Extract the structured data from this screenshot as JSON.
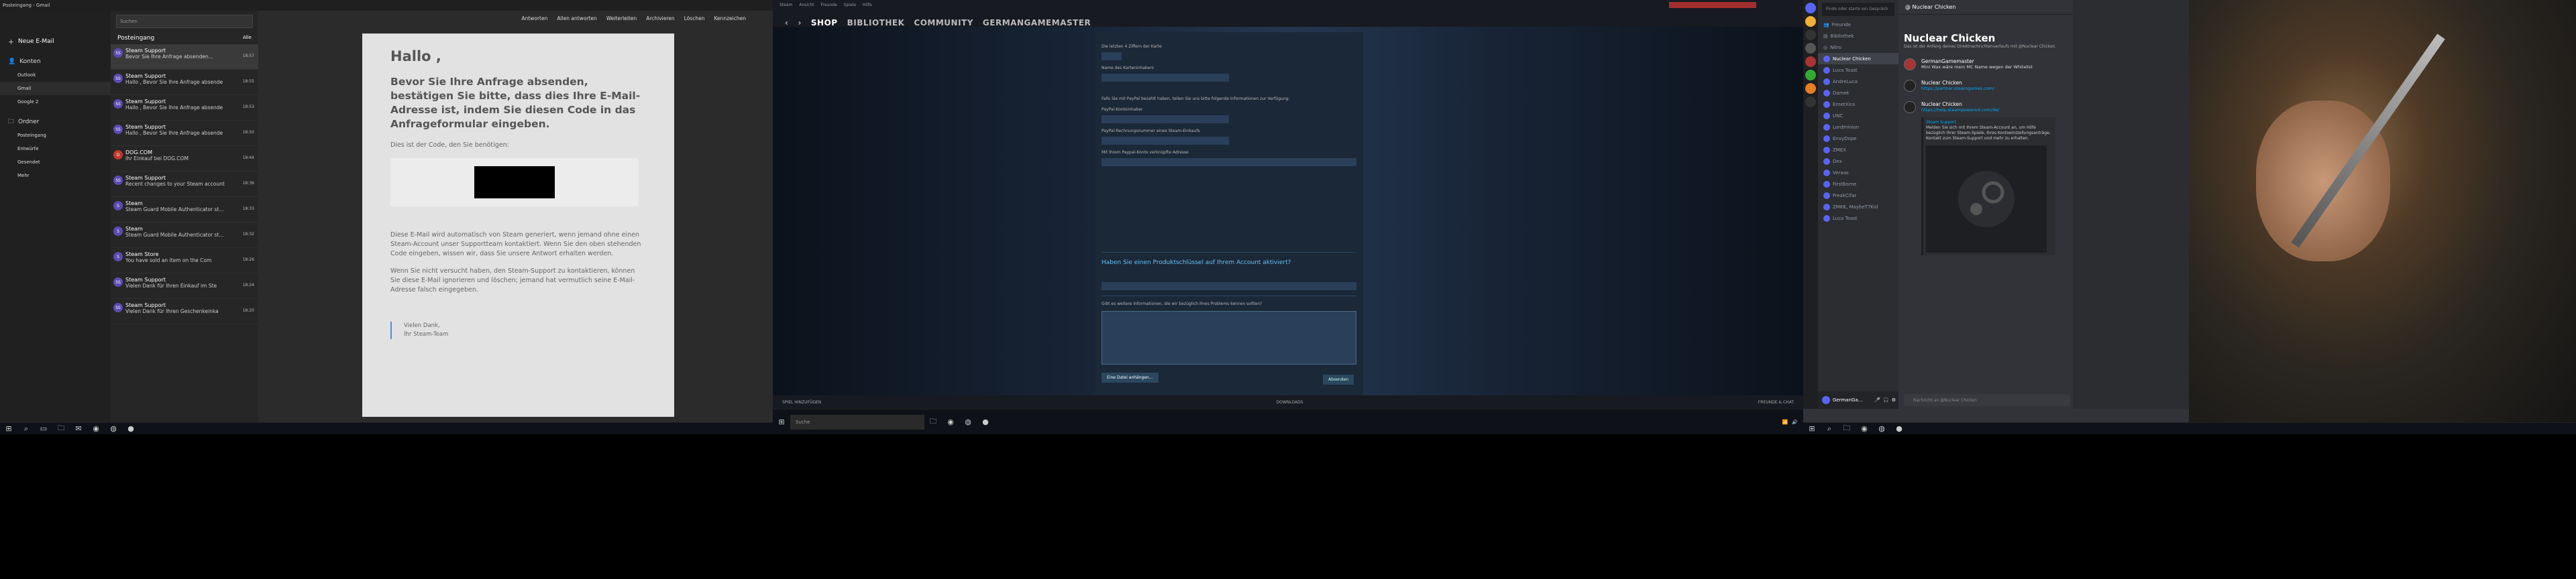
{
  "mail": {
    "title": "Posteingang - Gmail",
    "search_placeholder": "Suchen",
    "new_mail": "Neue E-Mail",
    "accounts": "Konten",
    "folders_label": "Ordner",
    "nav_items": [
      "Outlook",
      "Gmail",
      "Google 2"
    ],
    "folders": [
      "Posteingang",
      "Entwürfe",
      "Gesendet",
      "Mehr"
    ],
    "list_header": "Posteingang",
    "list_filter": "Alle",
    "messages": [
      {
        "sender": "Steam Support",
        "subject": "Bevor Sie Ihre Anfrage absenden...",
        "time": "18:57"
      },
      {
        "sender": "Steam Support",
        "subject": "Hallo , Bevor Sie Ihre Anfrage absende",
        "time": "18:55"
      },
      {
        "sender": "Steam Support",
        "subject": "Hallo , Bevor Sie Ihre Anfrage absende",
        "time": "18:53"
      },
      {
        "sender": "Steam Support",
        "subject": "Hallo , Bevor Sie Ihre Anfrage absende",
        "time": "18:50"
      },
      {
        "sender": "DOG.COM",
        "subject": "Ihr Einkauf bei DOG.COM",
        "time": "18:44"
      },
      {
        "sender": "Steam Support",
        "subject": "Recent changes to your Steam account",
        "time": "18:36"
      },
      {
        "sender": "Steam",
        "subject": "Steam Guard Mobile Authenticator st...",
        "time": "18:33"
      },
      {
        "sender": "Steam",
        "subject": "Steam Guard Mobile Authenticator st...",
        "time": "18:32"
      },
      {
        "sender": "Steam Store",
        "subject": "You have sold an item on the Com",
        "time": "18:26"
      },
      {
        "sender": "Steam Support",
        "subject": "Vielen Dank für Ihren Einkauf im Ste",
        "time": "18:24"
      },
      {
        "sender": "Steam Support",
        "subject": "Vielen Dank für Ihren Geschenkeinka",
        "time": "18:20"
      }
    ],
    "toolbar": [
      "Antworten",
      "Allen antworten",
      "Weiterleiten",
      "Archivieren",
      "Löschen",
      "Kennzeichen"
    ],
    "body_hello": "Hallo ,",
    "body_heading": "Bevor Sie Ihre Anfrage absenden, bestätigen Sie bitte, dass dies Ihre E-Mail-Adresse ist, indem Sie diesen Code in das Anfrageformular eingeben.",
    "body_code_intro": "Dies ist der Code, den Sie benötigen:",
    "body_p1": "Diese E-Mail wird automatisch von Steam generiert, wenn jemand ohne einen Steam-Account unser Supportteam kontaktiert. Wenn Sie den oben stehenden Code eingeben, wissen wir, dass Sie unsere Antwort erhalten werden.",
    "body_p2": "Wenn Sie nicht versucht haben, den Steam-Support zu kontaktieren, können Sie diese E-Mail ignorieren und löschen; jemand hat vermutlich seine E-Mail-Adresse falsch eingegeben.",
    "sig1": "Vielen Dank,",
    "sig2": "Ihr Steam-Team"
  },
  "steam": {
    "top_menu": [
      "Steam",
      "Ansicht",
      "Freunde",
      "Spiele",
      "Hilfe"
    ],
    "nav": [
      "SHOP",
      "BIBLIOTHEK",
      "COMMUNITY",
      "GERMANGAMEMASTER"
    ],
    "labels": [
      "Die letzten 4 Ziffern der Karte",
      "Name des Karteninhabers",
      "Falls Sie mit PayPal bezahlt haben, teilen Sie uns bitte folgende Informationen zur Verfügung:",
      "PayPal-Kontoinhaber",
      "PayPal-Rechnungsnummer eines Steam-Einkaufs",
      "Mit Ihrem Paypal-Konto verknüpfte Adresse"
    ],
    "section_title": "Haben Sie einen Produktschlüssel auf Ihrem Account aktiviert?",
    "ta_label": "Gibt es weitere Informationen, die wir bezüglich Ihres Problems kennen sollten?",
    "attach": "Eine Datei anhängen...",
    "submit": "Absenden",
    "footer_left": "SPIEL HINZUFÜGEN",
    "footer_mid": "DOWNLOADS",
    "footer_right": "FREUNDE & CHAT"
  },
  "discord": {
    "channel_title": "Nuclear Chicken",
    "channels": [
      "Freunde",
      "Bibliothek",
      "Nitro",
      "Nuclear Chicken",
      "Luca Toast",
      "AndreLuca",
      "Damek",
      "ErnetXico",
      "UNC",
      "Lordminion",
      "EnvyDope",
      "ZMEX",
      "Dex",
      "Veraas",
      "FirstBorne",
      "FreakCifar",
      "ZMKK, MaybeT7Kid",
      "Luca Toast"
    ],
    "intro": "Das ist der Anfang deines Direktnachrichtenverlaufs mit @Nuclear Chicken.",
    "msg1_name": "GermanGamemaster",
    "msg1_text": "Mini Wax wäre mein MC Name wegen der Whitelist",
    "msg2_name": "Nuclear Chicken",
    "msg2_link": "https://partner.steamgames.com/",
    "msg3_name": "Nuclear Chicken",
    "msg3_link": "https://help.steampowered.com/de/",
    "embed_title": "Steam Support",
    "embed_text": "Melden Sie sich mit Ihrem Steam-Account an, um Hilfe bezüglich Ihrer Steam-Spiele, Ihres Kontoeinstellungsanträge, Kontakt zum Steam-Support und mehr zu erhalten.",
    "input_placeholder": "Nachricht an @Nuclear Chicken",
    "user": "GermanGa..."
  }
}
